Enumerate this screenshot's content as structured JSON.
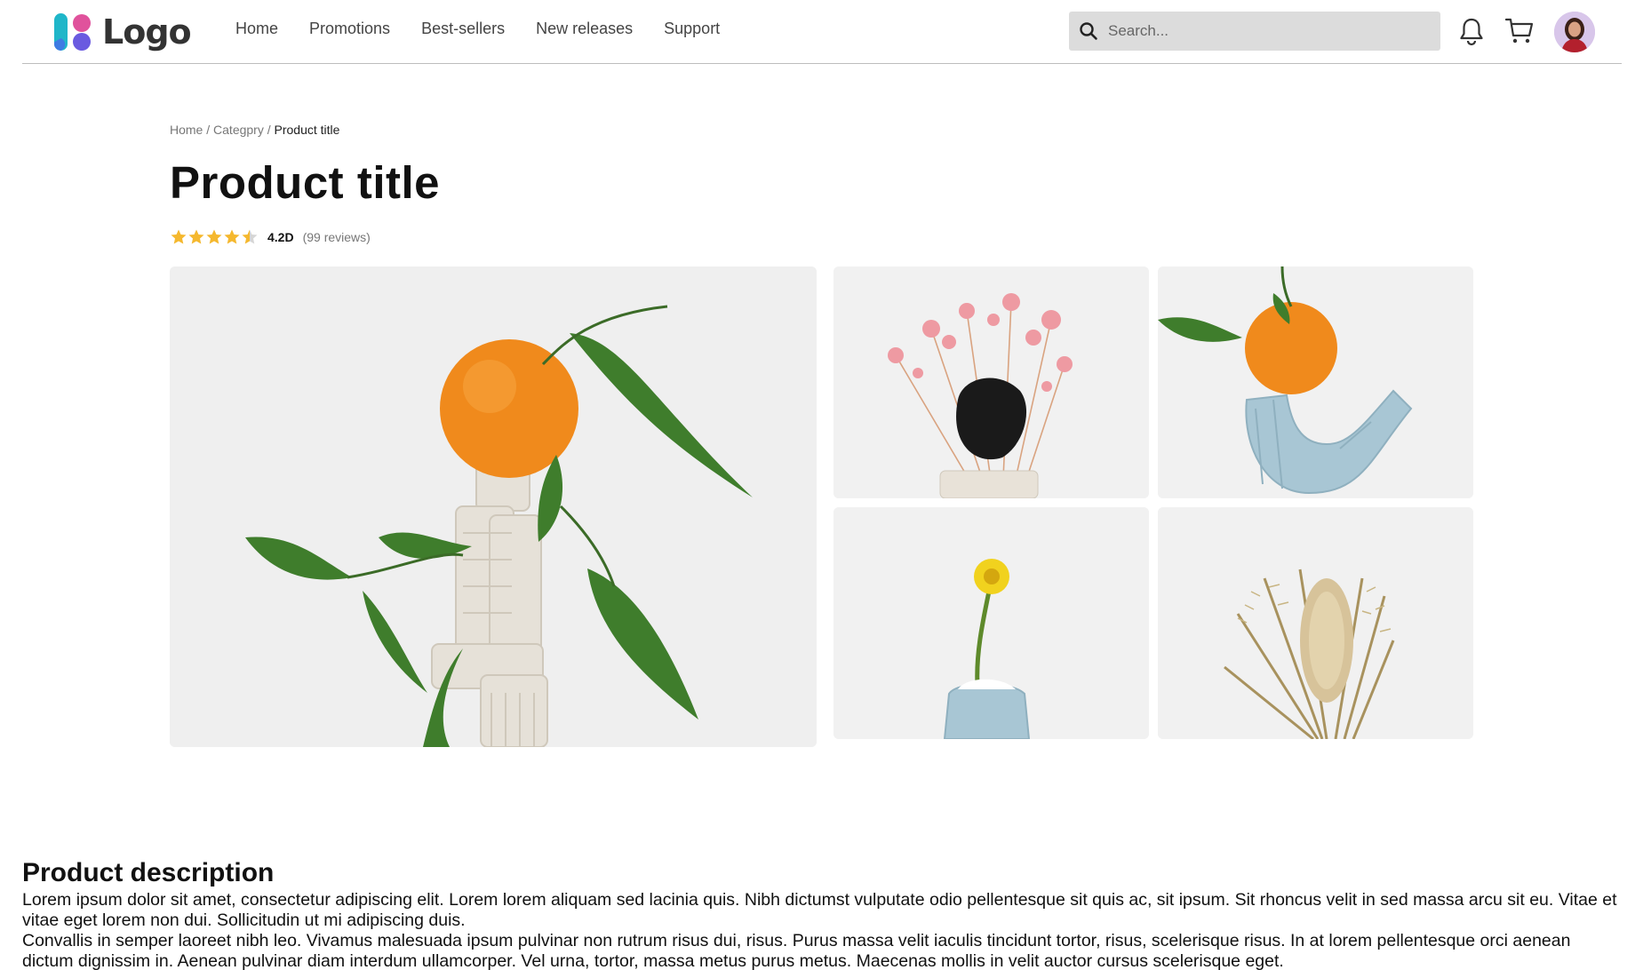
{
  "header": {
    "logo_text": "Logo",
    "nav": [
      {
        "label": "Home"
      },
      {
        "label": "Promotions"
      },
      {
        "label": "Best-sellers"
      },
      {
        "label": "New releases"
      },
      {
        "label": "Support"
      }
    ],
    "search": {
      "placeholder": "Search...",
      "value": ""
    },
    "icons": [
      "search-icon",
      "bell-icon",
      "cart-icon",
      "avatar"
    ]
  },
  "breadcrumb": {
    "items": [
      "Home",
      "Categpry"
    ],
    "separator": "/",
    "current": "Product title"
  },
  "product": {
    "title": "Product title",
    "rating_value": "4.2D",
    "rating_stars": 4.5,
    "review_count": "(99 reviews)"
  },
  "gallery": [
    {
      "subject": "orange-on-ceramic-sculpture"
    },
    {
      "subject": "pink-dried-flowers-with-black-stone"
    },
    {
      "subject": "orange-on-blue-ceramic"
    },
    {
      "subject": "yellow-flower-in-blue-vase"
    },
    {
      "subject": "dried-banksia-flower"
    }
  ],
  "description": {
    "title": "Product description",
    "paragraphs": [
      "Lorem ipsum dolor sit amet, consectetur adipiscing elit. Lorem lorem aliquam sed lacinia quis. Nibh dictumst vulputate odio pellentesque sit quis ac, sit ipsum. Sit rhoncus velit in sed massa arcu sit eu. Vitae et vitae eget lorem non dui. Sollicitudin ut mi adipiscing duis.",
      "Convallis in semper laoreet nibh leo. Vivamus malesuada ipsum pulvinar non rutrum risus dui, risus. Purus massa velit iaculis tincidunt tortor, risus, scelerisque risus. In at lorem pellentesque orci aenean dictum dignissim in. Aenean pulvinar diam interdum ullamcorper. Vel urna, tortor, massa metus purus metus. Maecenas mollis in velit auctor cursus scelerisque eget."
    ]
  },
  "colors": {
    "star": "#f5b82e",
    "search_bg": "#dcdcdc",
    "logo_teal": "#1fb6c9",
    "logo_pink": "#e0529c",
    "logo_purple": "#6a5ae0",
    "logo_blue": "#3e7be3",
    "divider": "#bdbdbd"
  }
}
